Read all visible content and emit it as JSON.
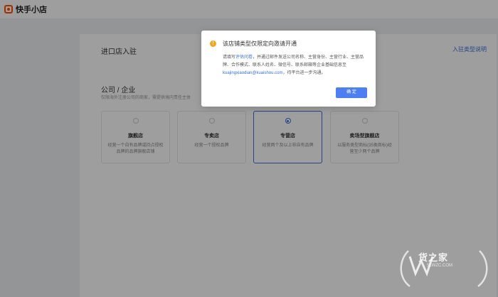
{
  "app": {
    "logo_text": "快手小店"
  },
  "page": {
    "title": "进口店入驻",
    "help_link": "入驻类型说明",
    "section_title": "公司 / 企业",
    "section_desc": "仅限海外注册公司的商家，需提供境内责任主体"
  },
  "cards": [
    {
      "name": "旗舰店",
      "desc": "经营一个自有品牌或持点授权品牌的品牌旗舰店铺",
      "selected": false
    },
    {
      "name": "专卖店",
      "desc": "经营一个授权品牌",
      "selected": false
    },
    {
      "name": "专营店",
      "desc": "经营两个及以上非自有品牌",
      "selected": true
    },
    {
      "name": "卖场型旗舰店",
      "desc": "以服务类型商标(35类商标)经营至少两个品牌",
      "selected": false
    }
  ],
  "dialog": {
    "title": "该店铺类型仅限定向邀请开通",
    "body_pre": "请填写",
    "body_link": "评估问卷",
    "body_mid": "，并通过邮件发送公司名称、主营身份、主营行业、主营品牌、合作模式、联系人姓名、微信号、联系邮箱等企业基础信息至",
    "body_email": "kuajingxiaodian@kuaishou.com",
    "body_post": "，待平台进一步沟通。",
    "confirm_label": "确 定"
  },
  "watermark": {
    "text": "货之家",
    "sub": "51WZC.COM"
  },
  "colors": {
    "accent": "#3b6fe0",
    "button": "#4d7ff2",
    "warning": "#f7a41d",
    "brand": "#ff5000"
  }
}
